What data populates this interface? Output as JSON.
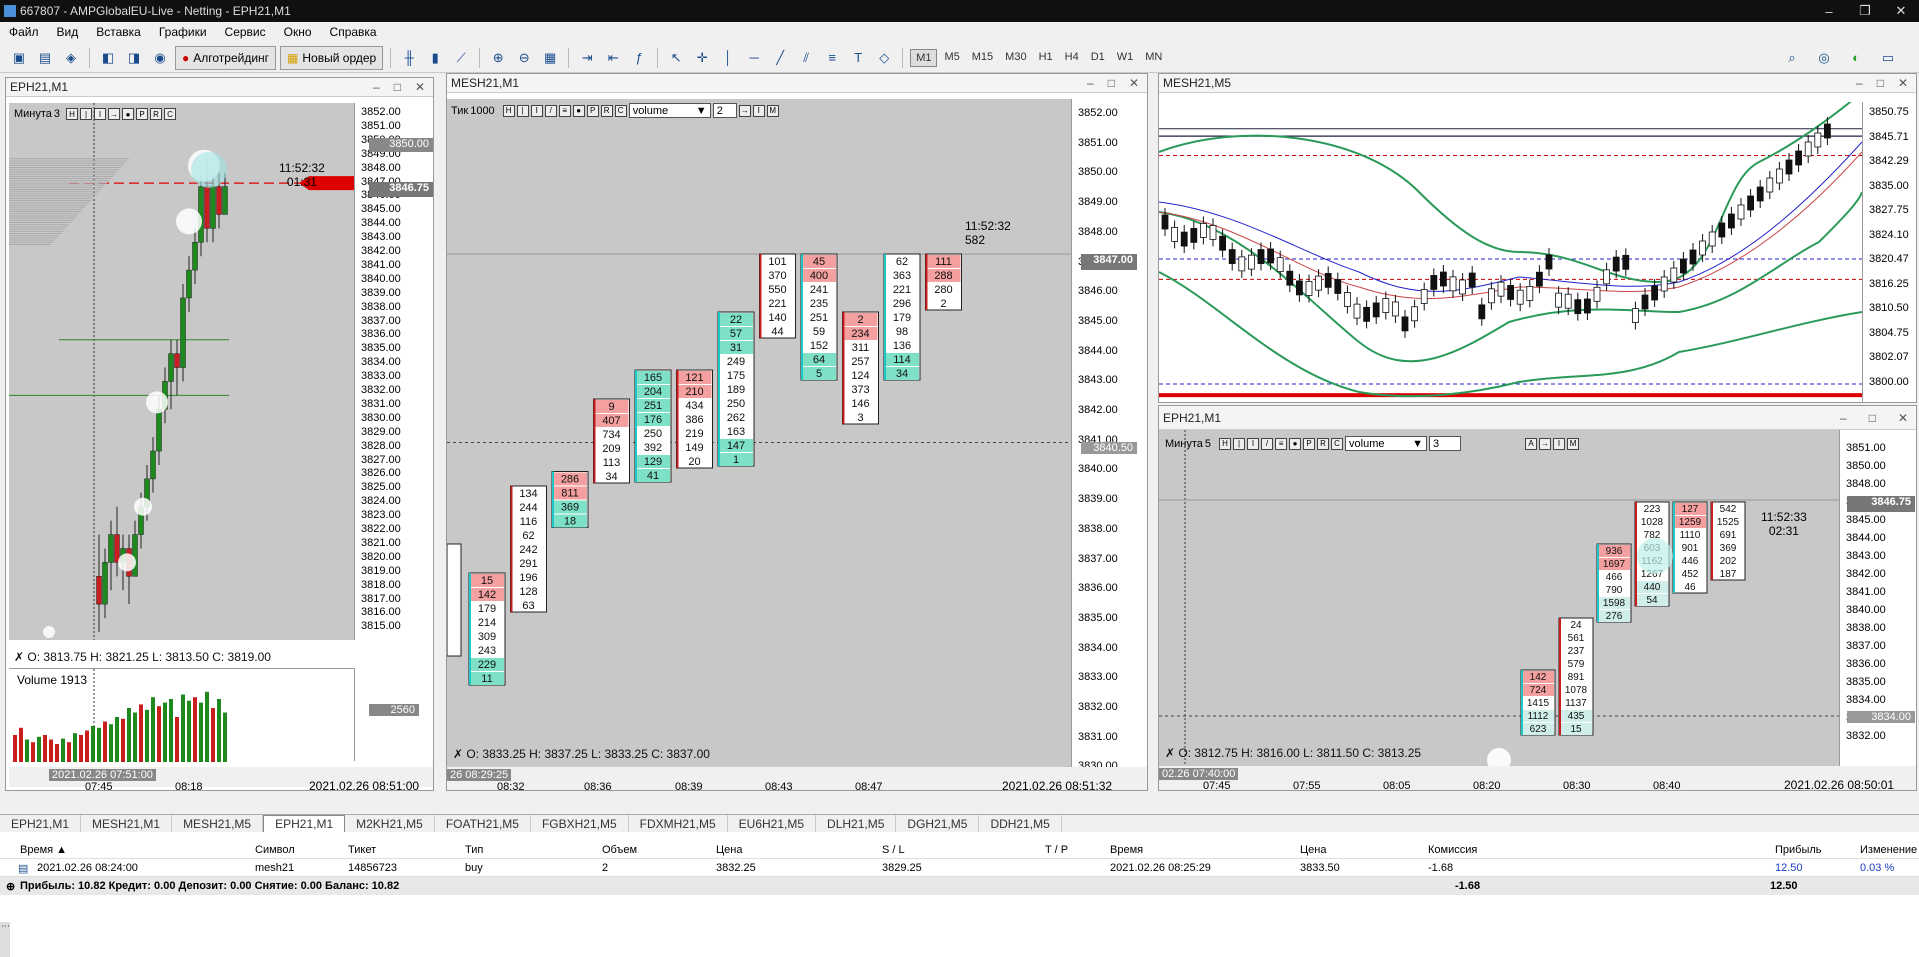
{
  "title": "667807 - AMPGlobalEU-Live - Netting - EPH21,M1",
  "menu": [
    "Файл",
    "Вид",
    "Вставка",
    "Графики",
    "Сервис",
    "Окно",
    "Справка"
  ],
  "toolbar": {
    "algo": "Алготрейдинг",
    "new_order": "Новый ордер",
    "timeframes": [
      "M1",
      "M5",
      "M15",
      "M30",
      "H1",
      "H4",
      "D1",
      "W1",
      "MN"
    ],
    "active_tf": "M1"
  },
  "w1": {
    "title": "EPH21,M1",
    "tf_label": "Минута",
    "tf_val": "3",
    "ohlc": "O: 3813.75  H: 3821.25  L: 3813.50  C: 3819.00",
    "volume_label": "Volume 1913",
    "vol_val": "2560",
    "countdown_time": "11:52:32",
    "countdown_left": "01:31",
    "price_tag": "3846.75",
    "hl": "3850.00",
    "cursor_time": "2021.02.26 07:51:00",
    "time_ticks": [
      "07:45",
      "08:18"
    ],
    "time_right": "2021.02.26 08:51:00",
    "prices": [
      "3852.00",
      "3851.00",
      "3850.00",
      "3849.00",
      "3848.00",
      "3847.00",
      "3846.00",
      "3845.00",
      "3844.00",
      "3843.00",
      "3842.00",
      "3841.00",
      "3840.00",
      "3839.00",
      "3838.00",
      "3837.00",
      "3836.00",
      "3835.00",
      "3834.00",
      "3833.00",
      "3832.00",
      "3831.00",
      "3830.00",
      "3829.00",
      "3828.00",
      "3827.00",
      "3826.00",
      "3825.00",
      "3824.00",
      "3823.00",
      "3822.00",
      "3821.00",
      "3820.00",
      "3819.00",
      "3818.00",
      "3817.00",
      "3816.00",
      "3815.00"
    ]
  },
  "w2": {
    "title": "MESH21,M1",
    "tick_label": "Тик",
    "tick_val": "1000",
    "vol_sel": "volume",
    "vol_n": "2",
    "ohlc": "O: 3833.25  H: 3837.25  L: 3833.25  C: 3837.00",
    "price_tag": "3847.00",
    "cross_price": "3840.50",
    "countdown_time": "11:52:32",
    "countdown_val": "582",
    "cursor_time": "26 08:29:25",
    "time_ticks": [
      "08:32",
      "08:36",
      "08:39",
      "08:43",
      "08:47"
    ],
    "time_right": "2021.02.26 08:51:32",
    "prices": [
      "3852.00",
      "3851.00",
      "3850.00",
      "3849.00",
      "3848.00",
      "3847.00",
      "3846.00",
      "3845.00",
      "3844.00",
      "3843.00",
      "3842.00",
      "3841.00",
      "3840.00",
      "3839.00",
      "3838.00",
      "3837.00",
      "3836.00",
      "3835.00",
      "3834.00",
      "3833.00",
      "3832.00",
      "3831.00",
      "3830.00"
    ],
    "clusters": [
      [
        "15",
        "142",
        "179",
        "214",
        "309",
        "243",
        "229",
        "11"
      ],
      [
        "134",
        "244",
        "116",
        "62",
        "242",
        "291",
        "196",
        "128",
        "63"
      ],
      [
        "286",
        "811",
        "369",
        "18"
      ],
      [
        "9",
        "407",
        "734",
        "209",
        "113",
        "34"
      ],
      [
        "165",
        "204",
        "251",
        "176",
        "250",
        "392",
        "129",
        "41"
      ],
      [
        "121",
        "210",
        "434",
        "386",
        "219",
        "149",
        "20"
      ],
      [
        "22",
        "57",
        "31",
        "249",
        "175",
        "189",
        "250",
        "262",
        "163",
        "147",
        "1"
      ],
      [
        "101",
        "370",
        "550",
        "221",
        "140",
        "44"
      ],
      [
        "45",
        "400",
        "241",
        "235",
        "251",
        "59",
        "152",
        "64",
        "5"
      ],
      [
        "2",
        "234",
        "311",
        "257",
        "124",
        "373",
        "146",
        "3"
      ],
      [
        "62",
        "363",
        "221",
        "296",
        "179",
        "98",
        "136",
        "114",
        "34"
      ],
      [
        "111",
        "288",
        "280",
        "2"
      ]
    ]
  },
  "w3": {
    "title": "MESH21,M5",
    "prices": [
      "3850.75",
      "3845.71",
      "3842.29",
      "3835.00",
      "3827.75",
      "3824.10",
      "3820.47",
      "3816.25",
      "3810.50",
      "3804.75",
      "3802.07",
      "3800.00"
    ]
  },
  "w4": {
    "title": "EPH21,M1",
    "tf_label": "Минута",
    "tf_val": "5",
    "vol_sel": "volume",
    "vol_n": "3",
    "ohlc": "O: 3812.75  H: 3816.00  L: 3811.50  C: 3813.25",
    "price_tag": "3846.75",
    "cross_price": "3834.00",
    "countdown_time": "11:52:33",
    "countdown_left": "02:31",
    "cursor_time": "02.26 07:40:00",
    "time_ticks": [
      "07:45",
      "07:55",
      "08:05",
      "08:20",
      "08:30",
      "08:40"
    ],
    "time_right": "2021.02.26 08:50:01",
    "prices": [
      "3851.00",
      "3850.00",
      "3848.00",
      "3846.00",
      "3845.00",
      "3844.00",
      "3843.00",
      "3842.00",
      "3841.00",
      "3840.00",
      "3838.00",
      "3837.00",
      "3836.00",
      "3835.00",
      "3834.00",
      "3833.00",
      "3832.00"
    ],
    "clusters": [
      [
        "142",
        "724",
        "1415",
        "1112",
        "623"
      ],
      [
        "24",
        "561",
        "237",
        "579",
        "891",
        "1078",
        "1137",
        "435",
        "15"
      ],
      [
        "936",
        "1697",
        "466",
        "790",
        "1598",
        "276"
      ],
      [
        "223",
        "1028",
        "782",
        "603",
        "1162",
        "1267",
        "440",
        "54"
      ],
      [
        "127",
        "1259",
        "1110",
        "901",
        "446",
        "452",
        "46"
      ],
      [
        "542",
        "1525",
        "691",
        "369",
        "202",
        "187"
      ]
    ]
  },
  "tabs": [
    "EPH21,M1",
    "MESH21,M1",
    "MESH21,M5",
    "EPH21,M1",
    "M2KH21,M5",
    "FOATH21,M5",
    "FGBXH21,M5",
    "FDXMH21,M5",
    "EU6H21,M5",
    "DLH21,M5",
    "DGH21,M5",
    "DDH21,M5"
  ],
  "active_tab": 3,
  "table": {
    "headers": [
      "Время",
      "Символ",
      "Тикет",
      "Тип",
      "Объем",
      "Цена",
      "S / L",
      "T / P",
      "Время",
      "Цена",
      "Комиссия",
      "Прибыль",
      "Изменение"
    ],
    "row": [
      "2021.02.26 08:24:00",
      "mesh21",
      "14856723",
      "buy",
      "2",
      "3832.25",
      "3829.25",
      "",
      "2021.02.26 08:25:29",
      "3833.50",
      "-1.68",
      "12.50",
      "0.03 %"
    ],
    "summary": "Прибыль: 10.82  Кредит: 0.00  Депозит: 0.00  Снятие: 0.00  Баланс: 10.82",
    "sum_comm": "-1.68",
    "sum_profit": "12.50"
  },
  "colors": {
    "bull": "#1e8a1e",
    "bear": "#c81e1e",
    "cluster_red": "#f4a0a0",
    "cluster_green": "#7fe0c8",
    "cluster_border": "#1ec8c8"
  }
}
